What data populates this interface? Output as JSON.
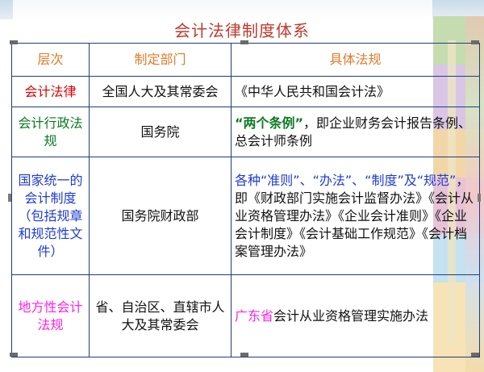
{
  "title": "会计法律制度体系",
  "headers": {
    "level": "层次",
    "dept": "制定部门",
    "laws": "具体法规"
  },
  "colors": {
    "title": "#c0392b",
    "header": "#e07b2b",
    "border": "#1f3c80",
    "red": "#e00000",
    "green": "#0a7a21",
    "blue": "#1f3cd2",
    "magenta": "#ff22e6"
  },
  "rows": [
    {
      "level": "会计法律",
      "dept": "全国人大及其常委会",
      "laws": "《中华人民共和国会计法》"
    },
    {
      "level": "会计行政法规",
      "dept": "国务院",
      "laws_lead": "“两个条例”",
      "laws_rest": "，即企业财务会计报告条例、总会计师条例"
    },
    {
      "level": "国家统一的会计制度（包括规章和规范性文件）",
      "dept": "国务院财政部",
      "laws_lead": "各种“准则”、“办法”、“制度”及“规范”",
      "laws_rest": "，即《财政部门实施会计监督办法》《会计从业资格管理办法》《企业会计准则》《企业会计制度》《会计基础工作规范》《会计档案管理办法》"
    },
    {
      "level": "地方性会计法规",
      "dept": "省、自治区、直辖市人大及其常委会",
      "laws_lead": "广东省",
      "laws_rest": "会计从业资格管理实施办法"
    }
  ]
}
